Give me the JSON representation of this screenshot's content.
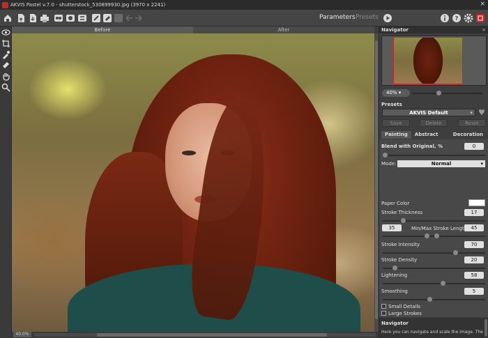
{
  "window": {
    "title": "AKVIS Pastel v.7.0 - shutterstock_530899930.jpg (3970 x 2241)",
    "close_glyph": "×"
  },
  "toolbar": {
    "buttons": [
      "home-icon",
      "open-icon",
      "save-icon",
      "print-icon",
      "batch-icon",
      "share-icon",
      "plugin-icon",
      "brush-icon",
      "eraser-icon",
      "undo-icon",
      "redo-icon"
    ],
    "parameters_label": "Parameters",
    "presets_label": "Presets",
    "right_icons": [
      "info-icon",
      "help-icon",
      "settings-icon",
      "akvis-logo-icon"
    ]
  },
  "tools": [
    "eye-icon",
    "crop-icon",
    "dropper-icon",
    "eraser-icon",
    "hand-icon",
    "zoom-icon"
  ],
  "canvas": {
    "tab_before": "Before",
    "tab_after": "After",
    "zoom_status": "40.0%"
  },
  "navigator": {
    "title": "Navigator",
    "close": "×",
    "zoom": "40%",
    "zoom_arrow": "▾",
    "zoom_level": 40
  },
  "presets": {
    "title": "Presets",
    "selected": "AKVIS Default",
    "dropdown_arrow": "▾",
    "heart": "♥",
    "save": "Save",
    "delete": "Delete",
    "reset": "Reset"
  },
  "tabs": [
    "Painting",
    "Abstract Art",
    "Decoration"
  ],
  "painting": {
    "blend_label": "Blend with Original, %",
    "blend_value": "0",
    "mode_label": "Mode:",
    "mode_value": "Normal",
    "mode_arrow": "▾",
    "paper_color_label": "Paper Color",
    "paper_color": "#ffffff",
    "stroke_thickness_label": "Stroke Thickness",
    "stroke_thickness": "17",
    "stroke_length_min": "35",
    "stroke_length_label": "Min/Max Stroke Length",
    "stroke_length_max": "45",
    "stroke_intensity_label": "Stroke Intensity",
    "stroke_intensity": "70",
    "stroke_density_label": "Stroke Density",
    "stroke_density": "20",
    "lightening_label": "Lightening",
    "lightening": "58",
    "smoothing_label": "Smoothing",
    "smoothing": "5",
    "small_details_label": "Small Details",
    "large_strokes_label": "Large Strokes"
  },
  "help": {
    "title": "Navigator",
    "text": "Here you can navigate and scale the image. The"
  },
  "colors": {
    "accent": "#c62828",
    "panel": "#3e3e3e",
    "toolbar": "#454545"
  }
}
